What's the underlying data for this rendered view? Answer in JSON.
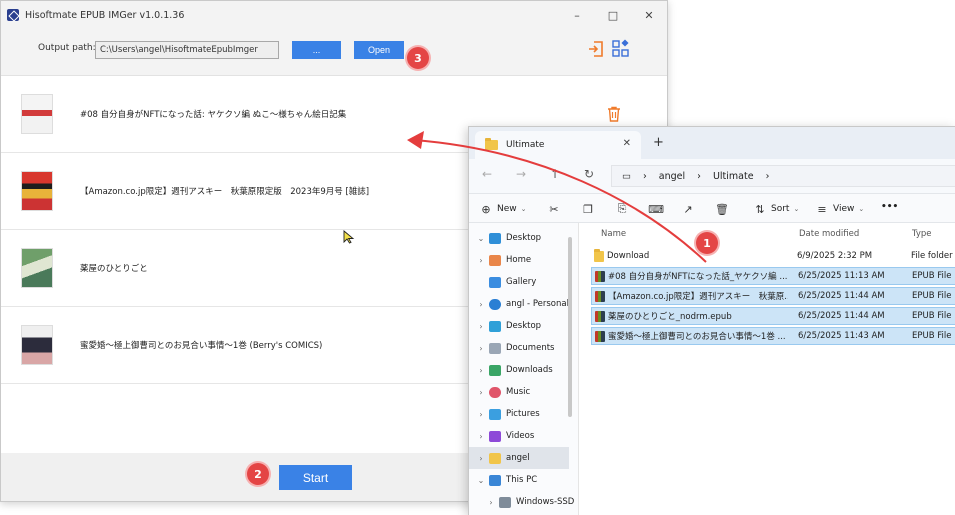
{
  "app": {
    "title": "Hisoftmate EPUB IMGer v1.0.1.36",
    "output_label": "Output path:",
    "output_path": "C:\\Users\\angel\\HisoftmateEpubImger",
    "browse_label": "...",
    "open_label": "Open",
    "start_label": "Start",
    "books": [
      {
        "title": "#08 自分自身がNFTになった話: ヤケクソ編 ぬこ～様ちゃん絵日記集"
      },
      {
        "title": "【Amazon.co.jp限定】週刊アスキー　秋葉原限定版　2023年9月号 [雑誌]"
      },
      {
        "title": "薬屋のひとりごと"
      },
      {
        "title": "蜜愛婚～極上御曹司とのお見合い事情～1巻 (Berry's COMICS)"
      }
    ],
    "accent_color": "#3a82e6",
    "icon_color": "#f07b2b"
  },
  "badges": {
    "one": "1",
    "two": "2",
    "three": "3"
  },
  "explorer": {
    "tab_title": "Ultimate",
    "breadcrumb": [
      "angel",
      "Ultimate"
    ],
    "commands": {
      "new": "New",
      "sort": "Sort",
      "view": "View",
      "more": "•••"
    },
    "columns": {
      "name": "Name",
      "date": "Date modified",
      "type": "Type"
    },
    "nav_items": [
      {
        "label": "Desktop"
      },
      {
        "label": "Home"
      },
      {
        "label": "Gallery"
      },
      {
        "label": "angl - Personal"
      },
      {
        "label": "Desktop"
      },
      {
        "label": "Documents"
      },
      {
        "label": "Downloads"
      },
      {
        "label": "Music"
      },
      {
        "label": "Pictures"
      },
      {
        "label": "Videos"
      },
      {
        "label": "angel"
      },
      {
        "label": "This PC"
      },
      {
        "label": "Windows-SSD"
      }
    ],
    "files": [
      {
        "name": "Download",
        "date": "6/9/2025 2:32 PM",
        "type": "File folder"
      },
      {
        "name": "#08 自分自身がNFTになった話_ヤケクソ編 ...",
        "date": "6/25/2025 11:13 AM",
        "type": "EPUB File"
      },
      {
        "name": "【Amazon.co.jp限定】週刊アスキー　秋葉原...",
        "date": "6/25/2025 11:44 AM",
        "type": "EPUB File"
      },
      {
        "name": "薬屋のひとりごと_nodrm.epub",
        "date": "6/25/2025 11:44 AM",
        "type": "EPUB File"
      },
      {
        "name": "蜜愛婚～極上御曹司とのお見合い事情～1巻 ...",
        "date": "6/25/2025 11:43 AM",
        "type": "EPUB File"
      }
    ]
  }
}
